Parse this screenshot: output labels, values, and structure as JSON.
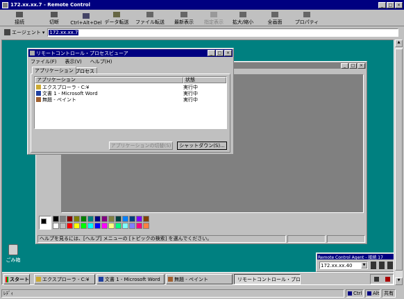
{
  "window": {
    "title": "172.xx.xx.7 - Remote Control"
  },
  "toolbar": {
    "connect": "接続",
    "disconnect": "切断",
    "cad": "Ctrl+Alt+Del",
    "transfer": "データ転送",
    "file": "ファイル転送",
    "refresh": "最新表示",
    "show": "指定表示",
    "zoom": "拡大/縮小",
    "fullscreen": "全画面",
    "props": "プロパティ"
  },
  "addressbar": {
    "label": "エージェント",
    "value": "172.xx.xx.7"
  },
  "viewer": {
    "title": "リモートコントロール・プロセスビューア",
    "menu": [
      "ファイル(F)",
      "表示(V)",
      "ヘルプ(H)"
    ],
    "tabs": [
      "アプリケーション",
      "プロセス"
    ],
    "col_app": "アプリケーション",
    "col_status": "状態",
    "rows": [
      {
        "name": "エクスプローラ - C:¥",
        "status": "実行中"
      },
      {
        "name": "文書 1 - Microsoft Word",
        "status": "実行中"
      },
      {
        "name": "無題 - ペイント",
        "status": "実行中"
      }
    ],
    "switch_btn": "アプリケーションの切替(S)",
    "shutdown_btn": "シャットダウン(S)..."
  },
  "paint": {
    "status": "ヘルプを見るには、[ヘルプ] メニューの [トピックの検索] を選んでください。",
    "palette": [
      "#000000",
      "#808080",
      "#800000",
      "#808000",
      "#008000",
      "#008080",
      "#000080",
      "#800080",
      "#808040",
      "#004040",
      "#0080ff",
      "#004080",
      "#8000ff",
      "#804000",
      "#ffffff",
      "#c0c0c0",
      "#ff0000",
      "#ffff00",
      "#00ff00",
      "#00ffff",
      "#0000ff",
      "#ff00ff",
      "#ffff80",
      "#00ff80",
      "#80ffff",
      "#8080ff",
      "#ff0080",
      "#ff8040"
    ]
  },
  "desktop": {
    "recycle": "ごみ箱"
  },
  "agent": {
    "title": "Remote Control Agent - 接続 17",
    "value": "172.xx.xx.40"
  },
  "taskbar": {
    "start": "スタート",
    "items": [
      "エクスプローラ - C:¥",
      "文書 1 - Microsoft Word",
      "無題 - ペイント",
      "リモートコントロール・プロ..."
    ]
  },
  "statusbar": {
    "ready": "ﾚﾃﾞｨ",
    "ctrl": "Ctrl",
    "alt": "Alt",
    "shared": "共有"
  },
  "colors": {
    "desktop": "#008080",
    "title": "#000080",
    "face": "#c0c0c0"
  }
}
